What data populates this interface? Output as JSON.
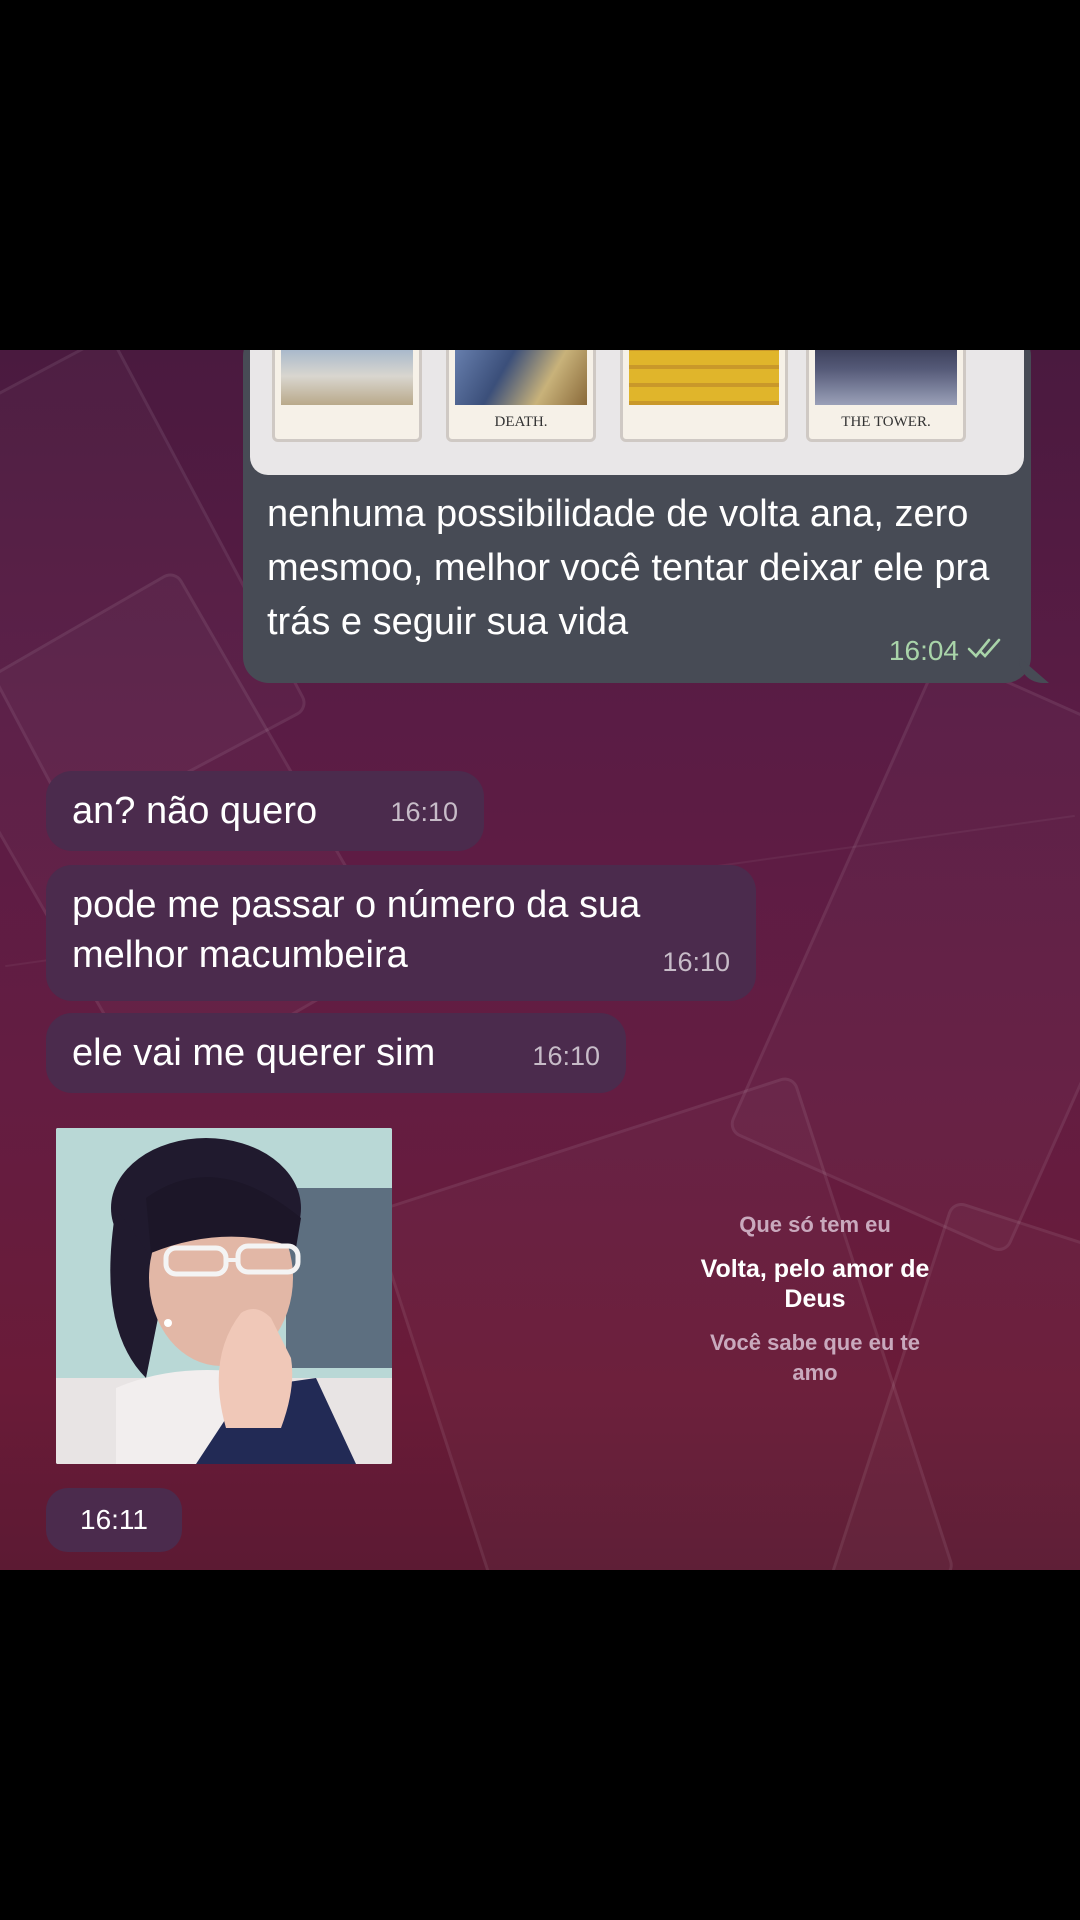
{
  "outgoing": {
    "tarot_labels": [
      "DEATH.",
      "THE TOWER."
    ],
    "text": "nenhuma possibilidade de volta ana, zero mesmoo, melhor você tentar deixar ele pra trás e seguir sua vida",
    "time": "16:04"
  },
  "incoming": [
    {
      "text": "an? não quero",
      "time": "16:10"
    },
    {
      "text": "pode me passar o número da sua melhor macumbeira",
      "time": "16:10"
    },
    {
      "text": "ele vai me querer sim",
      "time": "16:10"
    }
  ],
  "photo_message": {
    "time": "16:11"
  },
  "lyrics": {
    "line1": "Que só tem eu",
    "line2": "Volta, pelo amor de Deus",
    "line3": "Você sabe que eu te amo"
  },
  "colors": {
    "outgoing_bubble": "#474b55",
    "incoming_bubble": "#4b2b4d",
    "read_check": "#a9d4a9",
    "wallpaper": "#5a1c45"
  }
}
